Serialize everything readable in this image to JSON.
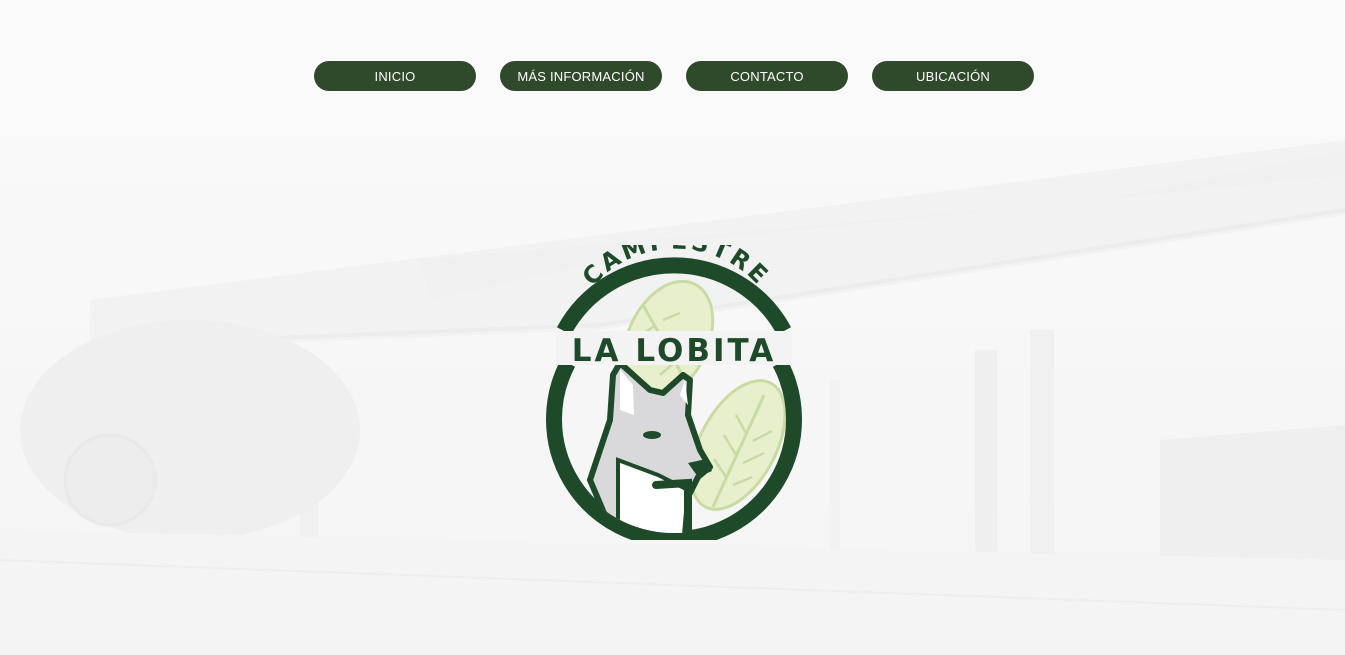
{
  "nav": {
    "items": [
      {
        "label": "INICIO"
      },
      {
        "label": "MÁS INFORMACIÓN"
      },
      {
        "label": "CONTACTO"
      },
      {
        "label": "UBICACIÓN"
      }
    ]
  },
  "logo": {
    "arc_text": "CAMPESTRE",
    "name_text": "LA LOBITA",
    "icon": "wolf-leaf-emblem"
  },
  "colors": {
    "primary_green": "#2f4a2a",
    "logo_green": "#1e4a2a",
    "leaf_green": "#d7e6b8",
    "background": "#f6f6f6"
  }
}
